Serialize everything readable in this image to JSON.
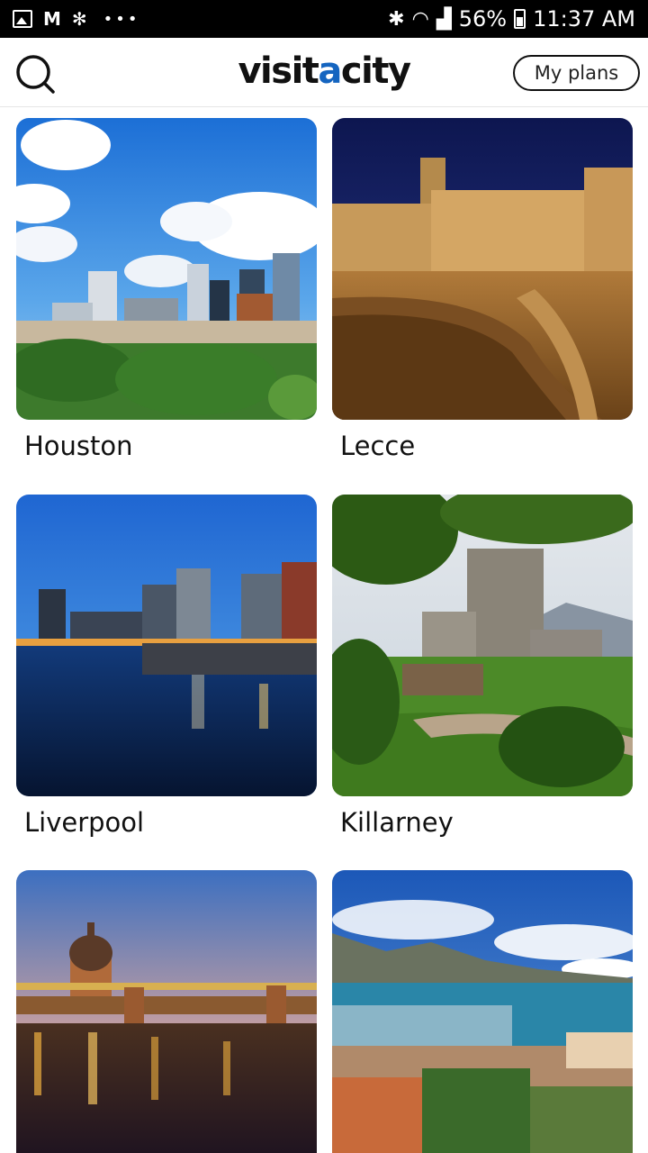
{
  "status_bar": {
    "battery": "56%",
    "time": "11:37 AM",
    "icons": [
      "gallery-icon",
      "gmail-icon",
      "fan-icon",
      "more-dots-icon",
      "bluetooth-icon",
      "wifi-icon",
      "signal-icon",
      "battery-icon"
    ]
  },
  "header": {
    "logo_part1": "visit",
    "logo_accent": "a",
    "logo_part2": "city",
    "my_plans_label": "My plans",
    "search_icon": "search-icon"
  },
  "cities": [
    {
      "name": "Houston"
    },
    {
      "name": "Lecce"
    },
    {
      "name": "Liverpool"
    },
    {
      "name": "Killarney"
    },
    {
      "name": ""
    },
    {
      "name": ""
    }
  ],
  "colors": {
    "accent": "#1565c0",
    "text": "#111111",
    "background": "#ffffff"
  }
}
